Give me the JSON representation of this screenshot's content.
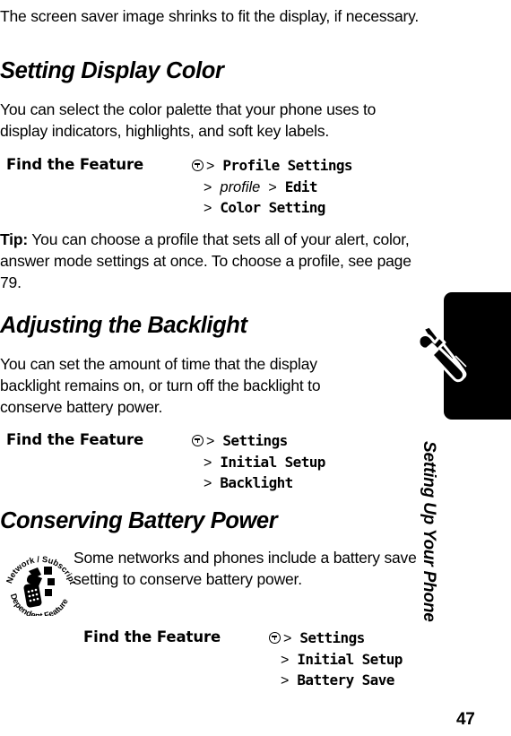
{
  "document": {
    "page_number": "47",
    "chapter_title": "Setting Up Your Phone"
  },
  "intro": {
    "text": "The screen saver image shrinks to fit the display, if necessary."
  },
  "sections": [
    {
      "heading": "Setting Display Color",
      "body": "You can select the color palette that your phone uses to display indicators, highlights, and soft key labels.",
      "find_feature": {
        "label": "Find the Feature",
        "icon": "menu-key-icon",
        "line1_sep": ">",
        "line1": "Profile Settings",
        "line2_sep": ">",
        "line2_italic": "profile",
        "line2_sep2": ">",
        "line2b": "Edit",
        "line3_sep": ">",
        "line3": "Color Setting"
      }
    },
    {
      "heading": "Adjusting the Backlight",
      "body": "You can set the amount of time that the display backlight remains on, or turn off the backlight to conserve battery power.",
      "find_feature": {
        "label": "Find the Feature",
        "icon": "menu-key-icon",
        "line1_sep": ">",
        "line1": "Settings",
        "line2_sep": ">",
        "line2": "Initial Setup",
        "line3_sep": ">",
        "line3": "Backlight"
      }
    },
    {
      "heading": "Conserving Battery Power",
      "body": "Some networks and phones include a battery save setting to conserve battery power.",
      "find_feature": {
        "label": "Find the Feature",
        "icon": "menu-key-icon",
        "line1_sep": ">",
        "line1": "Settings",
        "line2_sep": ">",
        "line2": "Initial Setup",
        "line3_sep": ">",
        "line3": "Battery Save"
      }
    }
  ],
  "tip": {
    "label": "Tip:",
    "text": " You can choose a profile that sets all of your alert, color, answer mode settings at once. To choose a profile, see page 79."
  },
  "network_badge": {
    "top_text": "Network / Subscription",
    "bottom_text": "Dependent Feature",
    "icon": "phone-with-signal-icon"
  },
  "colors": {
    "ink": "#000000",
    "paper": "#ffffff",
    "rail": "#000000"
  }
}
